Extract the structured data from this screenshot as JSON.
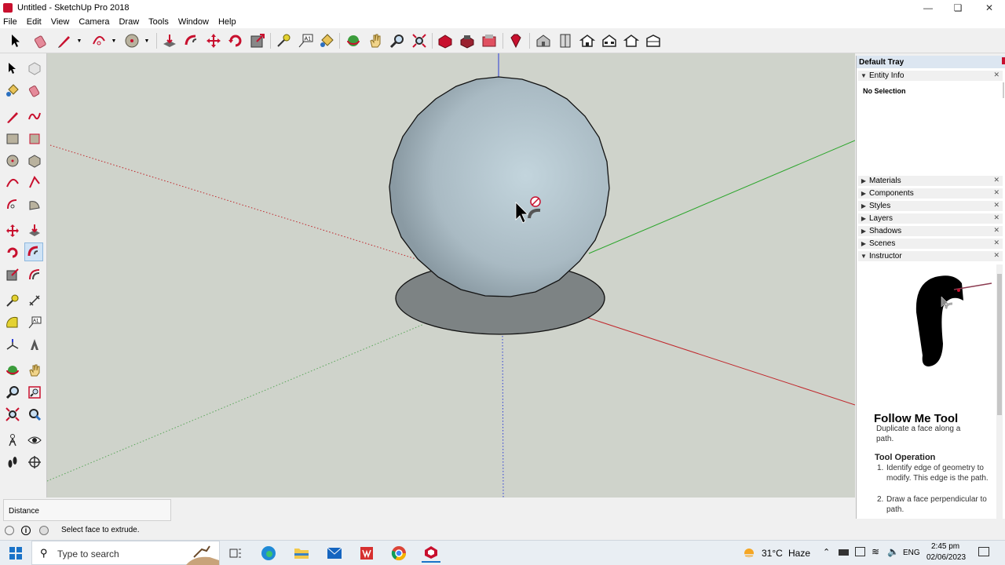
{
  "window": {
    "title": "Untitled - SketchUp Pro 2018",
    "controls": [
      "minimize-icon",
      "restore-icon",
      "close-icon"
    ]
  },
  "menu": [
    "File",
    "Edit",
    "View",
    "Camera",
    "Draw",
    "Tools",
    "Window",
    "Help"
  ],
  "tray": {
    "title": "Default Tray",
    "entity_info": {
      "label": "Entity Info",
      "selection": "No Selection"
    },
    "panels": [
      "Materials",
      "Components",
      "Styles",
      "Layers",
      "Shadows",
      "Scenes"
    ],
    "instructor": {
      "label": "Instructor",
      "tool_title": "Follow Me Tool",
      "tool_desc": "Duplicate a face along a path.",
      "op_title": "Tool Operation",
      "steps": [
        "Identify edge of geometry to modify. This edge is the path.",
        "Draw a face perpendicular to path."
      ]
    }
  },
  "status": {
    "measurement_label": "Distance",
    "hint": "Select face to extrude."
  },
  "taskbar": {
    "search_placeholder": "Type to search",
    "weather_temp": "31°C",
    "weather_desc": "Haze",
    "lang": "ENG",
    "time": "2:45 pm",
    "date": "02/06/2023"
  },
  "colors": {
    "viewport_bg": "#cfd3cb",
    "red_axis": "#c0262b",
    "green_axis": "#2aa52a",
    "blue_axis": "#2b3bd6",
    "sphere": "#b6c6cf",
    "disk": "#7d8384",
    "accent": "#c8102e"
  }
}
